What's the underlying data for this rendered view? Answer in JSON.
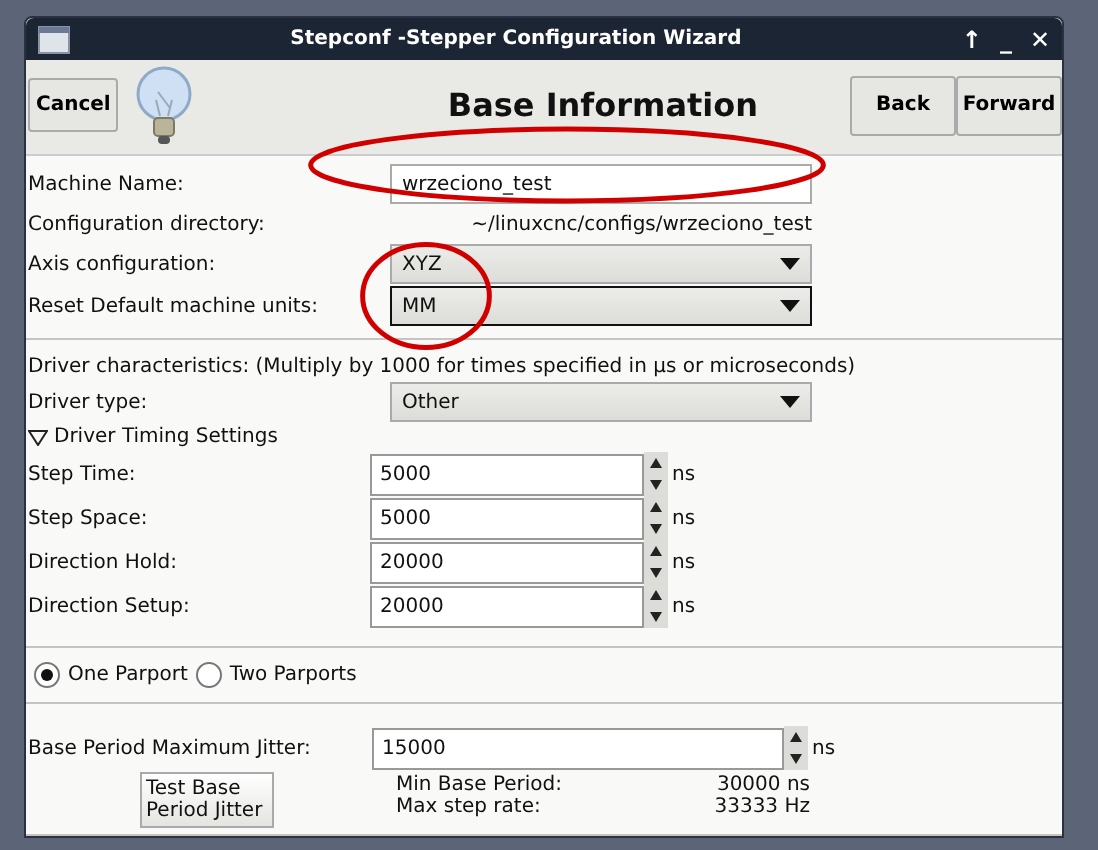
{
  "window": {
    "title": "Stepconf -Stepper Configuration Wizard",
    "controls": [
      "↑",
      "_",
      "✕"
    ]
  },
  "toolbar": {
    "cancel": "Cancel",
    "heading": "Base Information",
    "back": "Back",
    "forward": "Forward"
  },
  "machine": {
    "name_label": "Machine Name:",
    "name_value": "wrzeciono_test",
    "dir_label": "Configuration directory:",
    "dir_value": "~/linuxcnc/configs/wrzeciono_test",
    "axis_label": "Axis configuration:",
    "axis_value": "XYZ",
    "units_label": "Reset Default machine units:",
    "units_value": "MM"
  },
  "driver": {
    "note": "Driver characteristics: (Multiply by 1000 for times specified in µs or microseconds)",
    "type_label": "Driver type:",
    "type_value": "Other",
    "timing": {
      "label": "Driver Timing Settings",
      "expanded": true,
      "rows": [
        {
          "label": "Step Time:",
          "value": "5000",
          "unit": "ns"
        },
        {
          "label": "Step Space:",
          "value": "5000",
          "unit": "ns"
        },
        {
          "label": "Direction Hold:",
          "value": "20000",
          "unit": "ns"
        },
        {
          "label": "Direction Setup:",
          "value": "20000",
          "unit": "ns"
        }
      ]
    }
  },
  "parports": [
    {
      "label": "One Parport",
      "selected": true
    },
    {
      "label": "Two Parports",
      "selected": false
    }
  ],
  "jitter": {
    "label": "Base Period Maximum Jitter:",
    "value": "15000",
    "unit": "ns",
    "test_button": "Test Base Period Jitter",
    "stats": [
      {
        "label": "Min Base Period:",
        "value": "30000 ns"
      },
      {
        "label": "Max step rate:",
        "value": "33333 Hz"
      }
    ]
  },
  "annotations": [
    {
      "kind": "ellipse"
    },
    {
      "kind": "ellipse"
    }
  ]
}
